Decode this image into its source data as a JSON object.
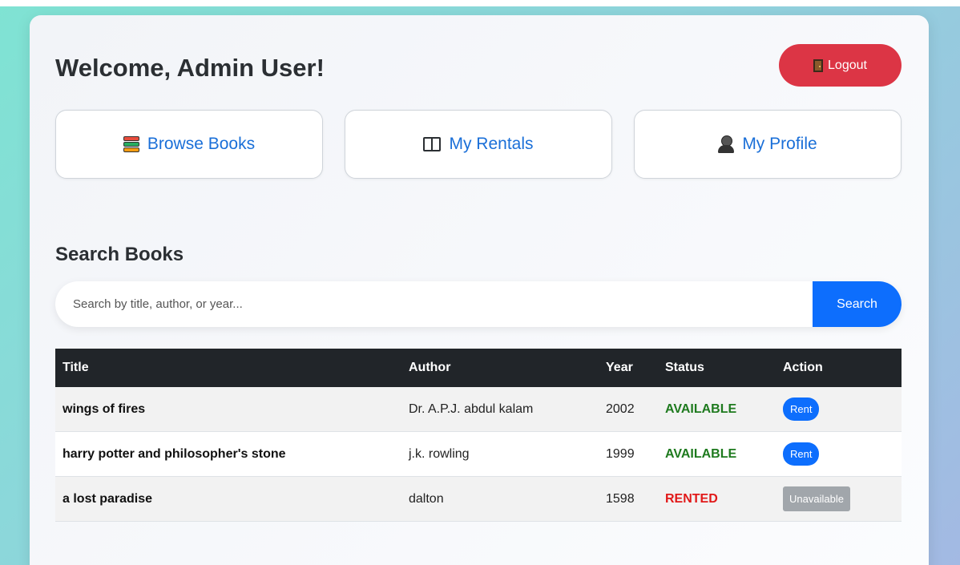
{
  "header": {
    "welcome": "Welcome, Admin User!",
    "logout_label": "Logout",
    "logout_icon": "door-icon"
  },
  "nav": [
    {
      "label": "Browse Books",
      "icon": "books-icon"
    },
    {
      "label": "My Rentals",
      "icon": "open-book-icon"
    },
    {
      "label": "My Profile",
      "icon": "person-icon"
    }
  ],
  "search": {
    "heading": "Search Books",
    "placeholder": "Search by title, author, or year...",
    "value": "",
    "button_label": "Search"
  },
  "table": {
    "headers": [
      "Title",
      "Author",
      "Year",
      "Status",
      "Action"
    ],
    "rows": [
      {
        "title": "wings of fires",
        "author": "Dr. A.P.J. abdul kalam",
        "year": "2002",
        "status": "AVAILABLE",
        "action": "Rent"
      },
      {
        "title": "harry potter and philosopher's stone",
        "author": "j.k. rowling",
        "year": "1999",
        "status": "AVAILABLE",
        "action": "Rent"
      },
      {
        "title": "a lost paradise",
        "author": "dalton",
        "year": "1598",
        "status": "RENTED",
        "action": "Unavailable"
      }
    ]
  },
  "colors": {
    "primary": "#0d6efd",
    "danger": "#dc3545",
    "available": "#1e7a1e",
    "rented": "#e11919",
    "table_header": "#212529"
  }
}
